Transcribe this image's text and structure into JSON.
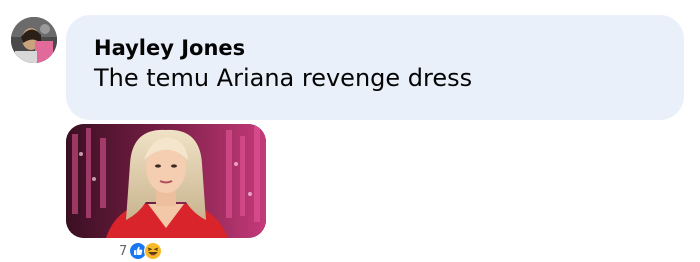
{
  "comment": {
    "author": "Hayley Jones",
    "text": "The temu Ariana revenge dress"
  },
  "attachment": {
    "type": "gif"
  },
  "reactions": {
    "count": "7",
    "icons": [
      "like-reaction-icon",
      "haha-reaction-icon"
    ]
  },
  "colors": {
    "bubble_bg": "#e9f0fa",
    "text": "#050505",
    "meta_text": "#65676b",
    "like_blue": "#1877f2",
    "haha_yellow": "#f7b928"
  }
}
